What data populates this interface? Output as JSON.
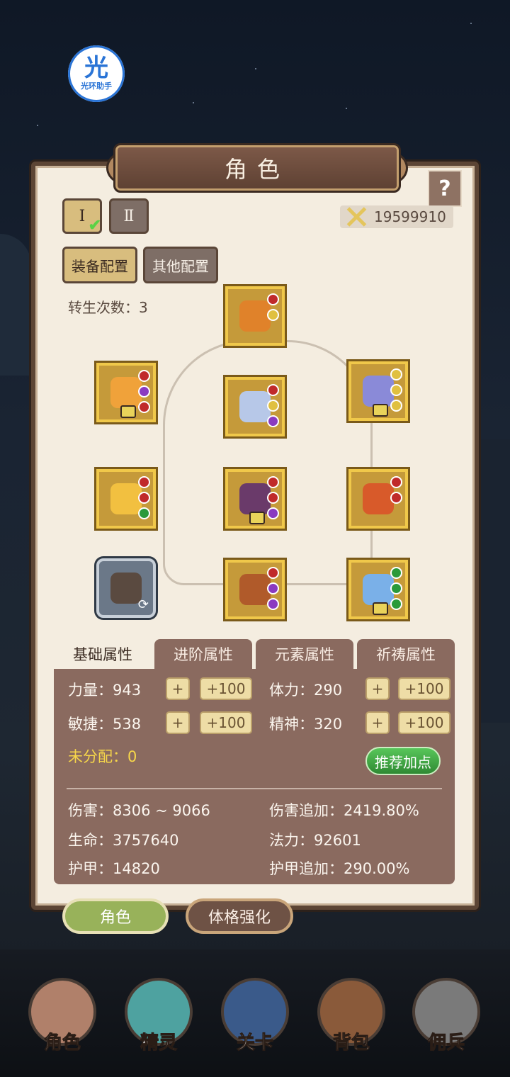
{
  "overlay": {
    "logo_glyph": "光",
    "logo_text": "光环助手"
  },
  "title": "角色",
  "help": "?",
  "tabs_small": [
    "Ⅰ",
    "Ⅱ"
  ],
  "power": "19599910",
  "config_buttons": [
    "装备配置",
    "其他配置"
  ],
  "rebirth": "转生次数：3",
  "attr_tabs": [
    "基础属性",
    "进阶属性",
    "元素属性",
    "祈祷属性"
  ],
  "base": {
    "strength": "力量：943",
    "agility": "敏捷：538",
    "stamina": "体力：290",
    "spirit": "精神：320",
    "plus": "+",
    "plus100": "+100",
    "unassigned": "未分配：0",
    "recommend": "推荐加点"
  },
  "stats": {
    "damage": "伤害：8306 ~ 9066",
    "damage_bonus": "伤害追加：2419.80%",
    "life": "生命：3757640",
    "mana": "法力：92601",
    "armor": "护甲：14820",
    "armor_bonus": "护甲追加：290.00%"
  },
  "bottom_tabs": [
    "角色",
    "体格强化"
  ],
  "nav": [
    "角色",
    "精灵",
    "关卡",
    "背包",
    "佣兵"
  ]
}
